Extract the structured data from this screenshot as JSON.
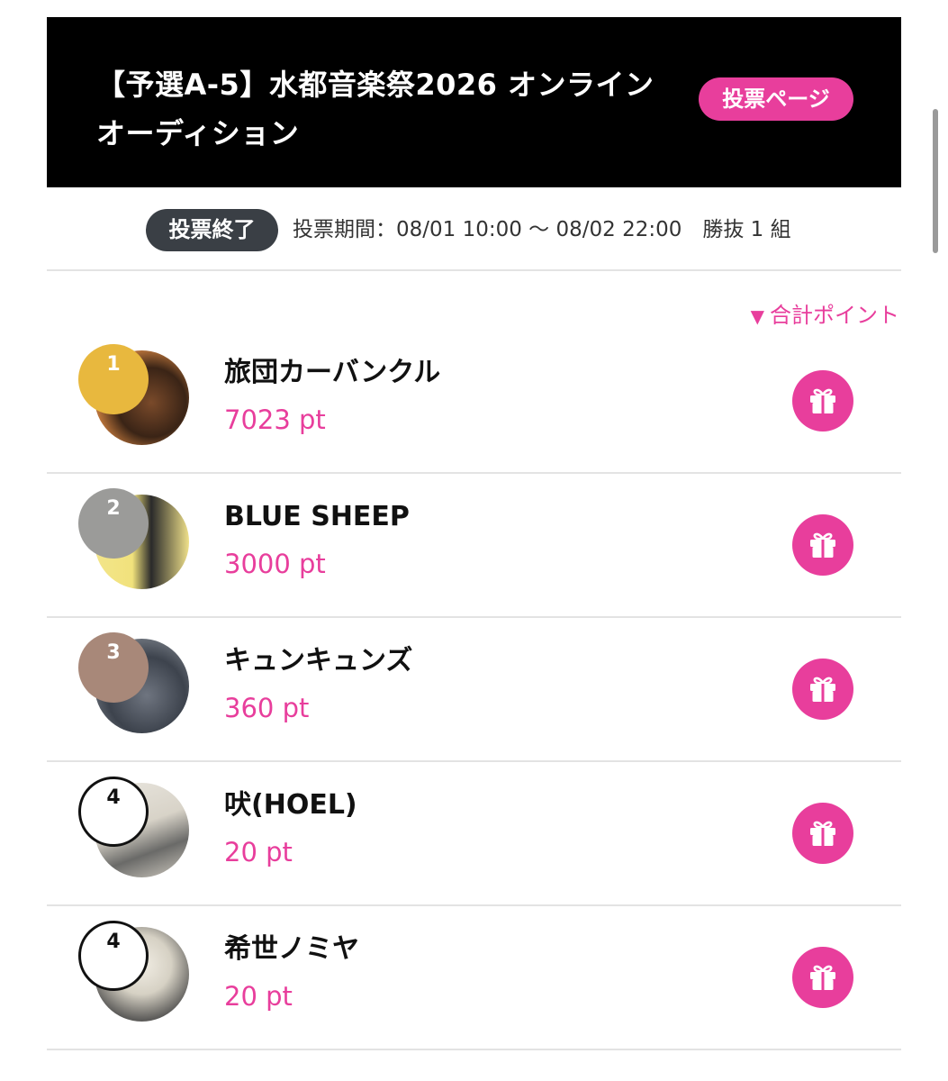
{
  "header": {
    "title": "【予選A-5】水都音楽祭2026 オンラインオーディション",
    "vote_button": "投票ページ"
  },
  "status": {
    "badge": "投票終了",
    "period": "投票期間：08/01 10:00 〜 08/02 22:00　勝抜 1 組"
  },
  "sort": {
    "label": "合計ポイント",
    "icon": "triangle-down-icon"
  },
  "colors": {
    "accent": "#e83e9c",
    "banner": "#000000",
    "badge": "#3a3f45",
    "rank_gold": "#e8b83e",
    "rank_silver": "#9b9b99",
    "rank_bronze": "#a88879"
  },
  "entries": [
    {
      "rank": "1",
      "name": "旅団カーバンクル",
      "points": "7023 pt"
    },
    {
      "rank": "2",
      "name": "BLUE SHEEP",
      "points": "3000 pt"
    },
    {
      "rank": "3",
      "name": "キュンキュンズ",
      "points": "360 pt"
    },
    {
      "rank": "4",
      "name": "吠(HOEL)",
      "points": "20 pt"
    },
    {
      "rank": "4",
      "name": "希世ノミヤ",
      "points": "20 pt"
    }
  ]
}
